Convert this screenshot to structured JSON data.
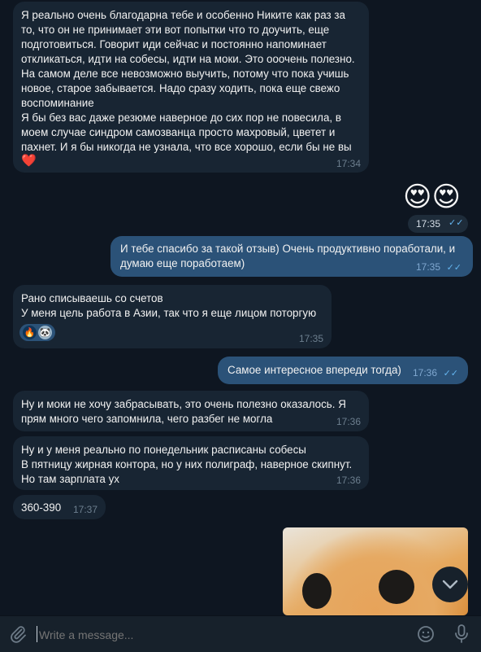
{
  "messages": [
    {
      "text": "Я реально очень благодарна тебе и особенно Никите как раз за то, что он не принимает эти вот попытки что то доучить, еще подготовиться. Говорит иди сейчас и постоянно напоминает откликаться, идти на собесы, идти на моки. Это ооочень полезно. На самом деле все невозможно выучить, потому что пока учишь новое, старое забывается. Надо сразу ходить, пока еще свежо воспоминание\nЯ бы без вас даже резюме наверное до сих пор не повесила, в моем случае синдром самозванца просто махровый, цветет и пахнет. И я бы никогда не узнала, что все хорошо, если бы не вы",
      "emoji": "❤️",
      "time": "17:34"
    },
    {
      "emoji": "😍😍",
      "time": "17:35"
    },
    {
      "text": "И тебе спасибо за такой отзыв) Очень продуктивно поработали, и думаю еще поработаем)",
      "time": "17:35"
    },
    {
      "text": "Рано списываешь со счетов\nУ меня цель работа в Азии, так что я еще лицом поторгую",
      "reactions": [
        "🔥",
        "🐼"
      ],
      "time": "17:35"
    },
    {
      "text": "Самое интересное впереди тогда)",
      "time": "17:36"
    },
    {
      "text": "Ну и моки не хочу забрасывать, это очень полезно оказалось. Я прям много чего запомнила, чего разбег не могла",
      "time": "17:36"
    },
    {
      "text": "Ну и у меня реально по понедельник расписаны собесы\nВ пятницу жирная контора, но у них полиграф, наверное скипнут. Но там зарплата ух",
      "time": "17:36"
    },
    {
      "text": "360-390",
      "time": "17:37"
    }
  ],
  "composer": {
    "placeholder": "Write a message..."
  },
  "colors": {
    "background": "#0e1621",
    "incoming": "#182533",
    "outgoing": "#2b5278",
    "check": "#64b5ef"
  },
  "icons": [
    "paperclip-icon",
    "smile-icon",
    "microphone-icon",
    "chevron-down-icon",
    "double-check-icon"
  ]
}
